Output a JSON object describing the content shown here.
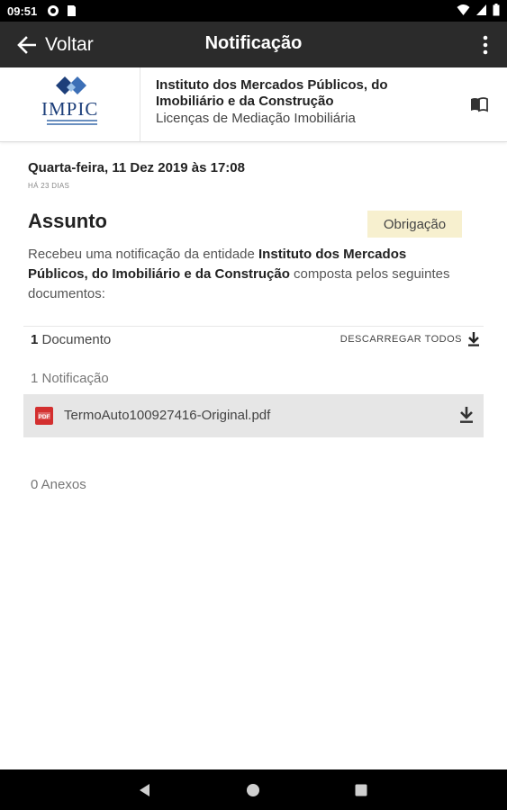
{
  "status_bar": {
    "time": "09:51"
  },
  "app_bar": {
    "back_label": "Voltar",
    "title": "Notificação"
  },
  "entity": {
    "logo_text": "IMPIC",
    "name": "Instituto dos Mercados Públicos, do Imobiliário e da Construção",
    "service": "Licenças de Mediação Imobiliária"
  },
  "notification": {
    "date": "Quarta-feira, 11 Dez 2019 às 17:08",
    "ago": "HÁ 23 DIAS",
    "subject_label": "Assunto",
    "badge": "Obrigação",
    "message_prefix": "Recebeu uma notificação da entidade ",
    "message_entity": "Instituto dos Mercados Públicos, do Imobiliário e da Construção",
    "message_suffix": " composta pelos seguintes documentos:"
  },
  "documents": {
    "count": "1",
    "count_label": " Documento",
    "download_all_label": "DESCARREGAR TODOS",
    "notifications_section": "1  Notificação",
    "files": [
      {
        "name": "TermoAuto100927416-Original.pdf"
      }
    ],
    "annexes_section": "0  Anexos"
  },
  "colors": {
    "app_bar": "#2b2b2b",
    "badge_bg": "#f7f0cf",
    "file_row_bg": "#e6e6e6",
    "pdf_red": "#d32f2f",
    "logo_blue": "#1d3f7a"
  }
}
